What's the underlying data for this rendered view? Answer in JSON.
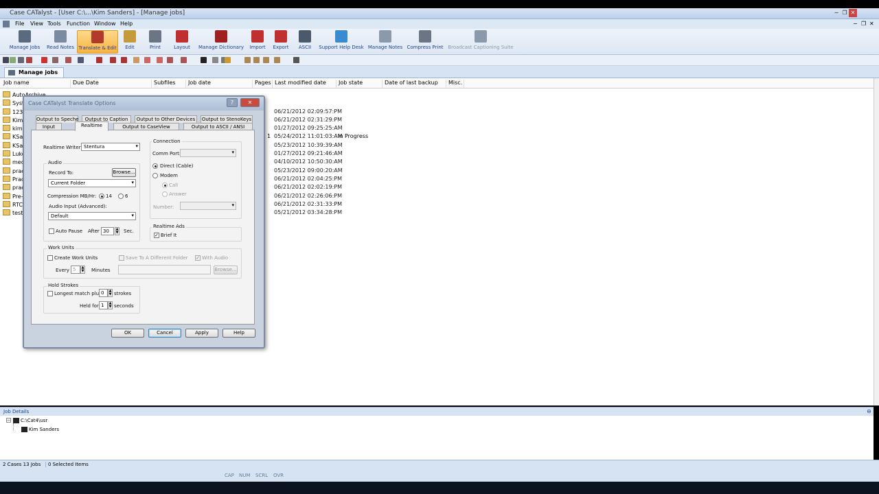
{
  "window": {
    "title": "Case CATalyst - [User C:\\...\\Kim Sanders] - [Manage jobs]",
    "controls": [
      "−",
      "❐",
      "✕"
    ],
    "child_controls": [
      "−",
      "❐",
      "✕"
    ]
  },
  "menu": [
    "File",
    "View",
    "Tools",
    "Function",
    "Window",
    "Help"
  ],
  "ribbon": [
    {
      "label": "Manage Jobs",
      "color": "#5a6b80"
    },
    {
      "label": "Read Notes",
      "color": "#7a8aa0"
    },
    {
      "label": "Translate & Edit",
      "color": "#b23a2a"
    },
    {
      "label": "Edit",
      "color": "#c59a3a"
    },
    {
      "label": "Print",
      "color": "#6a7686"
    },
    {
      "label": "Layout",
      "color": "#c03030"
    },
    {
      "label": "Manage Dictionary",
      "color": "#a02020"
    },
    {
      "label": "Import",
      "color": "#c03030"
    },
    {
      "label": "Export",
      "color": "#c03030"
    },
    {
      "label": "ASCII",
      "color": "#4a5a6a"
    },
    {
      "label": "Support Help Desk",
      "color": "#3a8ad0"
    },
    {
      "label": "Manage Notes",
      "color": "#8a9aaa"
    },
    {
      "label": "Compress Print",
      "color": "#6a7686"
    },
    {
      "label": "Broadcast Captioning Suite",
      "color": "#8a9aaa"
    }
  ],
  "tab": {
    "label": "Manage jobs"
  },
  "columns": [
    "Job name",
    "Due Date",
    "Subfiles",
    "Job date",
    "Pages",
    "Last modified date",
    "Job state",
    "Date of last backup",
    "Misc."
  ],
  "jobs": [
    {
      "name": "AutoArchive",
      "modified": "",
      "pages": "",
      "state": ""
    },
    {
      "name": "Syste",
      "modified": "",
      "pages": "",
      "state": ""
    },
    {
      "name": "123",
      "modified": "06/21/2012 02:09:57:PM",
      "pages": "",
      "state": ""
    },
    {
      "name": "Kim S",
      "modified": "06/21/2012 02:31:29:PM",
      "pages": "",
      "state": ""
    },
    {
      "name": "kimsi",
      "modified": "01/27/2012 09:25:25:AM",
      "pages": "",
      "state": ""
    },
    {
      "name": "KSand",
      "modified": "05/24/2012 11:01:03:AM",
      "pages": "1",
      "state": "In Progress"
    },
    {
      "name": "KSand",
      "modified": "05/23/2012 10:39:39:AM",
      "pages": "",
      "state": ""
    },
    {
      "name": "Luke",
      "modified": "01/27/2012 09:21:46:AM",
      "pages": "",
      "state": ""
    },
    {
      "name": "medi",
      "modified": "04/10/2012 10:50:30:AM",
      "pages": "",
      "state": ""
    },
    {
      "name": "pract",
      "modified": "05/23/2012 09:00:20:AM",
      "pages": "",
      "state": ""
    },
    {
      "name": "Practi",
      "modified": "06/21/2012 02:04:25:PM",
      "pages": "",
      "state": ""
    },
    {
      "name": "pract",
      "modified": "06/21/2012 02:02:19:PM",
      "pages": "",
      "state": ""
    },
    {
      "name": "Pre-tr",
      "modified": "06/21/2012 02:26:06:PM",
      "pages": "",
      "state": ""
    },
    {
      "name": "RTC T",
      "modified": "06/21/2012 02:31:33:PM",
      "pages": "",
      "state": ""
    },
    {
      "name": "testdl",
      "modified": "05/21/2012 03:34:28:PM",
      "pages": "",
      "state": ""
    }
  ],
  "dialog": {
    "title": "Case CATalyst Translate Options",
    "tabs_row1": [
      "Output to Speche",
      "Output to Caption",
      "Output to Other Devices",
      "Output to StenoKeys"
    ],
    "tabs_row2": [
      "Input",
      "Realtime",
      "Output to CaseView",
      "Output to ASCII / ANSI"
    ],
    "realtime_writer_label": "Realtime Writer:",
    "realtime_writer_value": "Stentura",
    "audio": {
      "group": "Audio",
      "record_to": "Record To:",
      "browse": "Browse...",
      "folder": "Current Folder",
      "compression": "Compression  MB/Hr:",
      "opt14": "14",
      "opt6": "6",
      "audio_input": "Audio Input (Advanced):",
      "audio_input_value": "Default",
      "auto_pause": "Auto Pause",
      "after": "After",
      "after_value": "30",
      "sec": "Sec."
    },
    "connection": {
      "group": "Connection",
      "comm_port": "Comm Port:",
      "direct": "Direct (Cable)",
      "modem": "Modem",
      "call": "Call",
      "answer": "Answer",
      "number": "Number:"
    },
    "realtime_ads": {
      "group": "Realtime Ads",
      "brief_it": "Brief It",
      "checkmark": "✓"
    },
    "work_units": {
      "group": "Work Units",
      "create": "Create Work Units",
      "save_to": "Save To A Different Folder",
      "with_audio": "With Audio",
      "every": "Every",
      "every_value": "5",
      "minutes": "Minutes",
      "browse": "Browse..."
    },
    "hold_strokes": {
      "group": "Hold Strokes",
      "longest": "Longest match plus",
      "longest_value": "0",
      "strokes": "strokes",
      "held_for": "Held for",
      "held_value": "1",
      "seconds": "seconds"
    },
    "buttons": {
      "ok": "OK",
      "cancel": "Cancel",
      "apply": "Apply",
      "help": "Help"
    }
  },
  "details": {
    "header": "Job Details",
    "root": "C:\\Cat4\\usr",
    "child": "Kim Sanders"
  },
  "status": {
    "cases": "2 Cases  13 Jobs",
    "selected": "0 Selected Items"
  },
  "indicators": [
    "CAP",
    "NUM",
    "SCRL",
    "OVR"
  ]
}
